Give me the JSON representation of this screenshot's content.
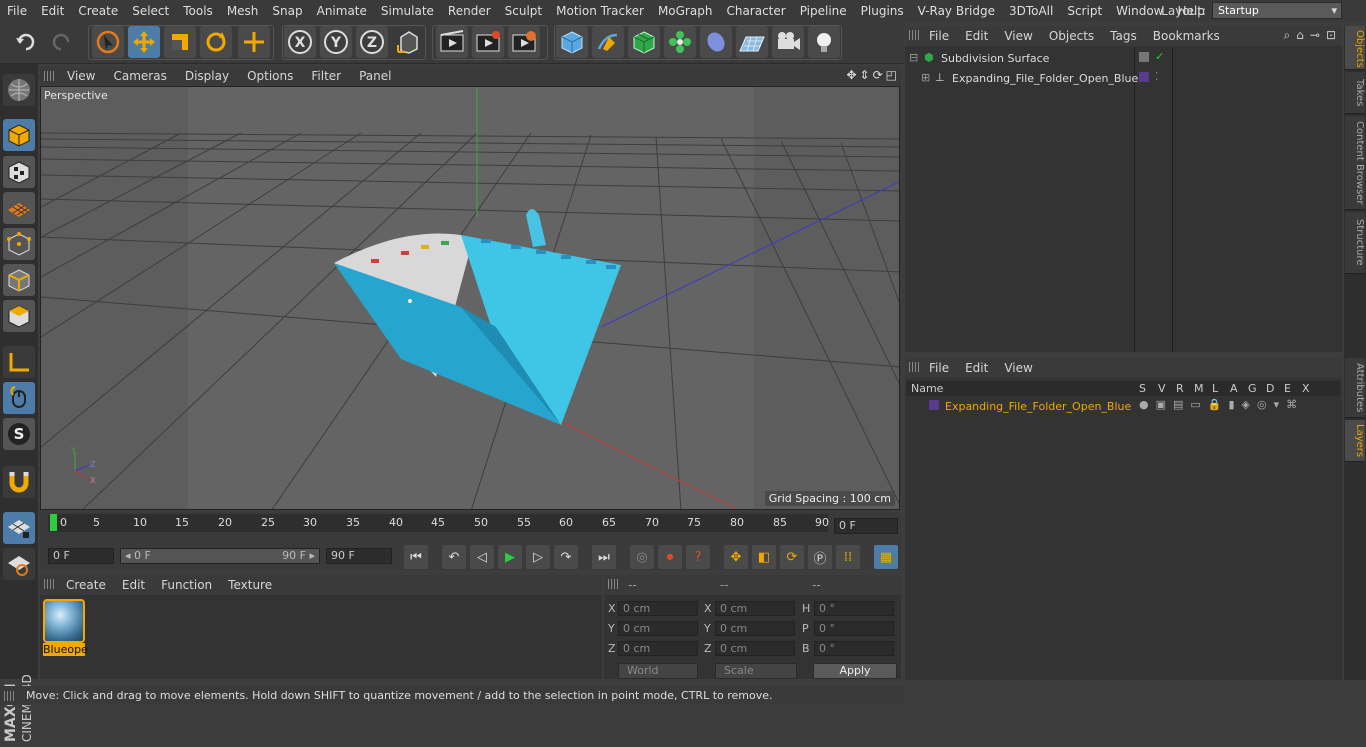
{
  "menubar": {
    "items": [
      "File",
      "Edit",
      "Create",
      "Select",
      "Tools",
      "Mesh",
      "Snap",
      "Animate",
      "Simulate",
      "Render",
      "Sculpt",
      "Motion Tracker",
      "MoGraph",
      "Character",
      "Pipeline",
      "Plugins",
      "V-Ray Bridge",
      "3DToAll",
      "Script",
      "Window",
      "Help"
    ],
    "layout_label": "Layout:",
    "layout_value": "Startup"
  },
  "viewport": {
    "menu": [
      "View",
      "Cameras",
      "Display",
      "Options",
      "Filter",
      "Panel"
    ],
    "label": "Perspective",
    "grid_spacing": "Grid Spacing : 100 cm"
  },
  "timeline": {
    "ticks": [
      "0",
      "5",
      "10",
      "15",
      "20",
      "25",
      "30",
      "35",
      "40",
      "45",
      "50",
      "55",
      "60",
      "65",
      "70",
      "75",
      "80",
      "85",
      "90"
    ],
    "current_frame": "0 F",
    "start_field": "0 F",
    "range_start": "◂ 0 F",
    "range_end": "90 F ▸",
    "end_field": "90 F"
  },
  "material_manager": {
    "menu": [
      "Create",
      "Edit",
      "Function",
      "Texture"
    ],
    "material_name": "Blueope"
  },
  "coordinates": {
    "head": [
      "--",
      "--",
      "--"
    ],
    "rows": [
      {
        "a": "X",
        "av": "0 cm",
        "b": "X",
        "bv": "0 cm",
        "c": "H",
        "cv": "0 °"
      },
      {
        "a": "Y",
        "av": "0 cm",
        "b": "Y",
        "bv": "0 cm",
        "c": "P",
        "cv": "0 °"
      },
      {
        "a": "Z",
        "av": "0 cm",
        "b": "Z",
        "bv": "0 cm",
        "c": "B",
        "cv": "0 °"
      }
    ],
    "world": "World",
    "scale": "Scale",
    "apply": "Apply"
  },
  "objects": {
    "menu": [
      "File",
      "Edit",
      "View",
      "Objects",
      "Tags",
      "Bookmarks"
    ],
    "items": [
      "Subdivision Surface",
      "Expanding_File_Folder_Open_Blue"
    ]
  },
  "layers": {
    "menu": [
      "File",
      "Edit",
      "View"
    ],
    "columns": [
      "Name",
      "S",
      "V",
      "R",
      "M",
      "L",
      "A",
      "G",
      "D",
      "E",
      "X"
    ],
    "row_name": "Expanding_File_Folder_Open_Blue"
  },
  "sidetabs": [
    "Objects",
    "Takes",
    "Content Browser",
    "Structure",
    "Attributes",
    "Layers"
  ],
  "status": "Move: Click and drag to move elements. Hold down SHIFT to quantize movement / add to the selection in point mode, CTRL to remove.",
  "brand": {
    "line1": "MAXON",
    "line2": "CINEMA 4D"
  },
  "colors": {
    "accent": "#f1a900",
    "selection": "#4d7ca8",
    "layer_color": "#5a3a8c"
  }
}
